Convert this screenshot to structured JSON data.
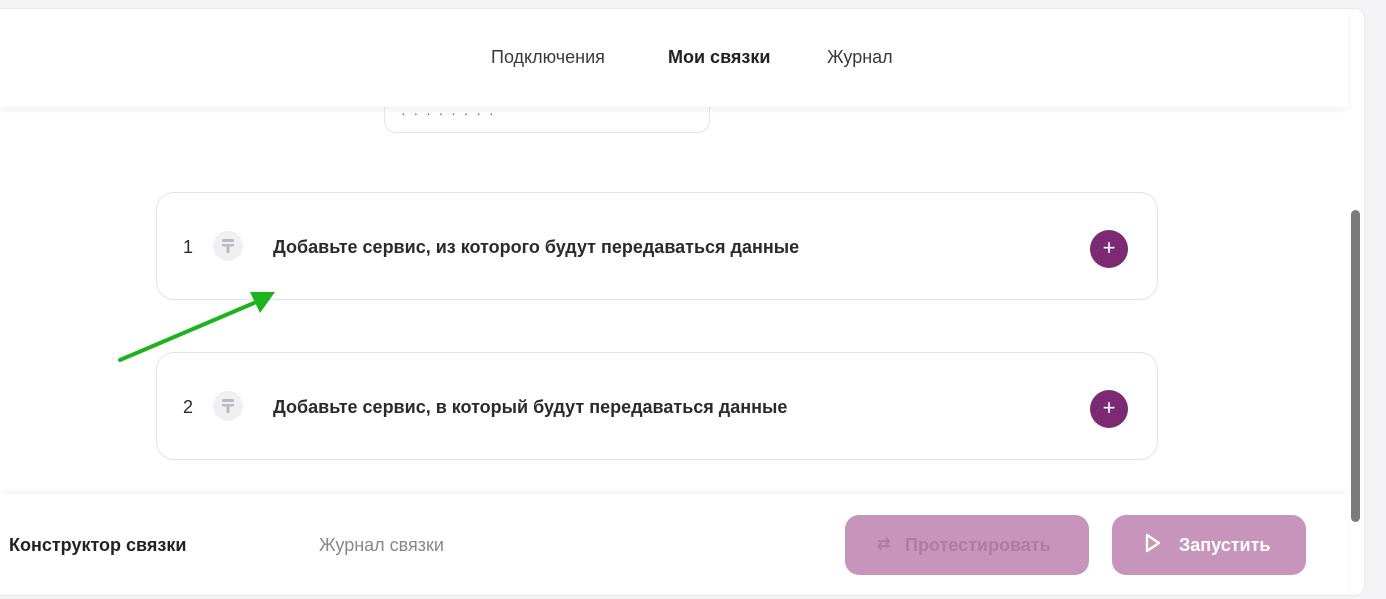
{
  "topnav": {
    "tabs": [
      {
        "label": "Подключения",
        "active": false
      },
      {
        "label": "Мои связки",
        "active": true
      },
      {
        "label": "Журнал",
        "active": false
      }
    ]
  },
  "steps": [
    {
      "number": "1",
      "title": "Добавьте сервис, из которого будут передаваться данные",
      "icon": "service-placeholder-icon",
      "add_label": "+"
    },
    {
      "number": "2",
      "title": "Добавьте сервис, в который будут передаваться данные",
      "icon": "service-placeholder-icon",
      "add_label": "+"
    }
  ],
  "bottombar": {
    "tab_builder": "Конструктор связки",
    "tab_log": "Журнал связки",
    "test_button": "Протестировать",
    "test_icon": "⇄",
    "run_button": "Запустить"
  },
  "colors": {
    "accent": "#7d2a74",
    "button_disabled": "#c795bc",
    "annotation_arrow": "#1db31d"
  }
}
